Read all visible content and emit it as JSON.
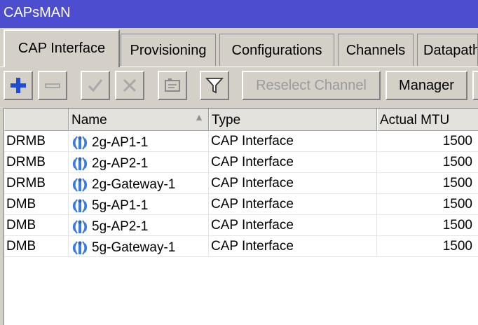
{
  "window": {
    "title": "CAPsMAN"
  },
  "tabs": [
    {
      "label": "CAP Interface",
      "active": true
    },
    {
      "label": "Provisioning"
    },
    {
      "label": "Configurations"
    },
    {
      "label": "Channels"
    },
    {
      "label": "Datapaths"
    }
  ],
  "toolbar": {
    "add_icon": "plus-icon",
    "remove_icon": "minus-icon",
    "enable_icon": "checkmark-icon",
    "disable_icon": "x-icon",
    "comment_icon": "comment-icon",
    "filter_icon": "filter-icon",
    "reselect_channel_label": "Reselect Channel",
    "manager_label": "Manager"
  },
  "table": {
    "columns": [
      "",
      "Name",
      "Type",
      "Actual MTU"
    ],
    "sorted_column": "Name",
    "rows": [
      {
        "flags": "DRMB",
        "icon": "antenna-icon",
        "name": "2g-AP1-1",
        "type": "CAP Interface",
        "mtu": "1500"
      },
      {
        "flags": "DRMB",
        "icon": "antenna-icon",
        "name": "2g-AP2-1",
        "type": "CAP Interface",
        "mtu": "1500"
      },
      {
        "flags": "DRMB",
        "icon": "antenna-icon",
        "name": "2g-Gateway-1",
        "type": "CAP Interface",
        "mtu": "1500"
      },
      {
        "flags": "DMB",
        "icon": "antenna-icon",
        "name": "5g-AP1-1",
        "type": "CAP Interface",
        "mtu": "1500"
      },
      {
        "flags": "DMB",
        "icon": "antenna-icon",
        "name": "5g-AP2-1",
        "type": "CAP Interface",
        "mtu": "1500"
      },
      {
        "flags": "DMB",
        "icon": "antenna-icon",
        "name": "5g-Gateway-1",
        "type": "CAP Interface",
        "mtu": "1500"
      }
    ]
  },
  "colors": {
    "titlebar": "#4d4dd0",
    "accent_icon": "#1e4bd8",
    "antenna_icon": "#3a7be0"
  }
}
